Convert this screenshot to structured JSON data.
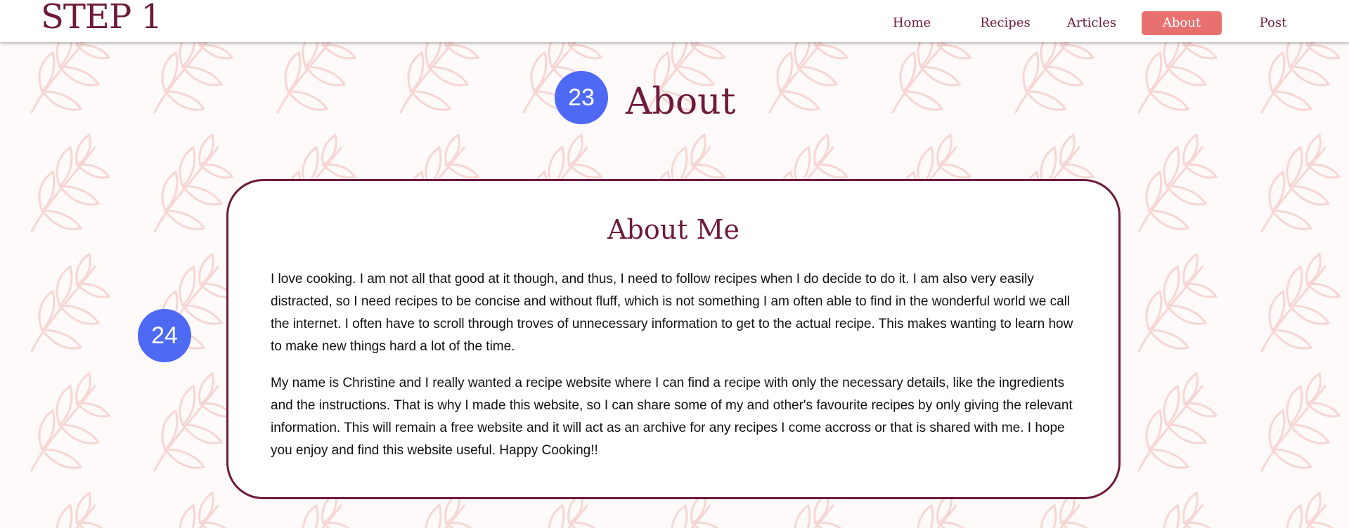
{
  "header": {
    "logo": "STEP 1",
    "nav": [
      {
        "label": "Home",
        "active": false
      },
      {
        "label": "Recipes",
        "active": false
      },
      {
        "label": "Articles",
        "active": false
      },
      {
        "label": "About",
        "active": true
      },
      {
        "label": "Post",
        "active": false
      }
    ]
  },
  "markers": {
    "title_marker": "23",
    "card_marker": "24"
  },
  "main": {
    "title": "About",
    "card": {
      "heading": "About Me",
      "paragraphs": [
        "I love cooking. I am not all that good at it though, and thus, I need to follow recipes when I do decide to do it. I am also very easily distracted, so I need recipes to be concise and without fluff, which is not something I am often able to find in the wonderful world we call the internet. I often have to scroll through troves of unnecessary information to get to the actual recipe. This makes wanting to learn how to make new things hard a lot of the time.",
        "My name is Christine and I really wanted a recipe website where I can find a recipe with only the necessary details, like the ingredients and the instructions. That is why I made this website, so I can share some of my and other's favourite recipes by only giving the relevant information. This will remain a free website and it will act as an archive for any recipes I come accross or that is shared with me. I hope you enjoy and find this website useful. Happy Cooking!!"
      ]
    }
  },
  "colors": {
    "brand": "#6e1a3c",
    "active_nav": "#e87170",
    "marker": "#4e6af4",
    "leaf_pattern": "#f7d6d3"
  },
  "icons": {
    "background": "leaf-branch-icon"
  }
}
